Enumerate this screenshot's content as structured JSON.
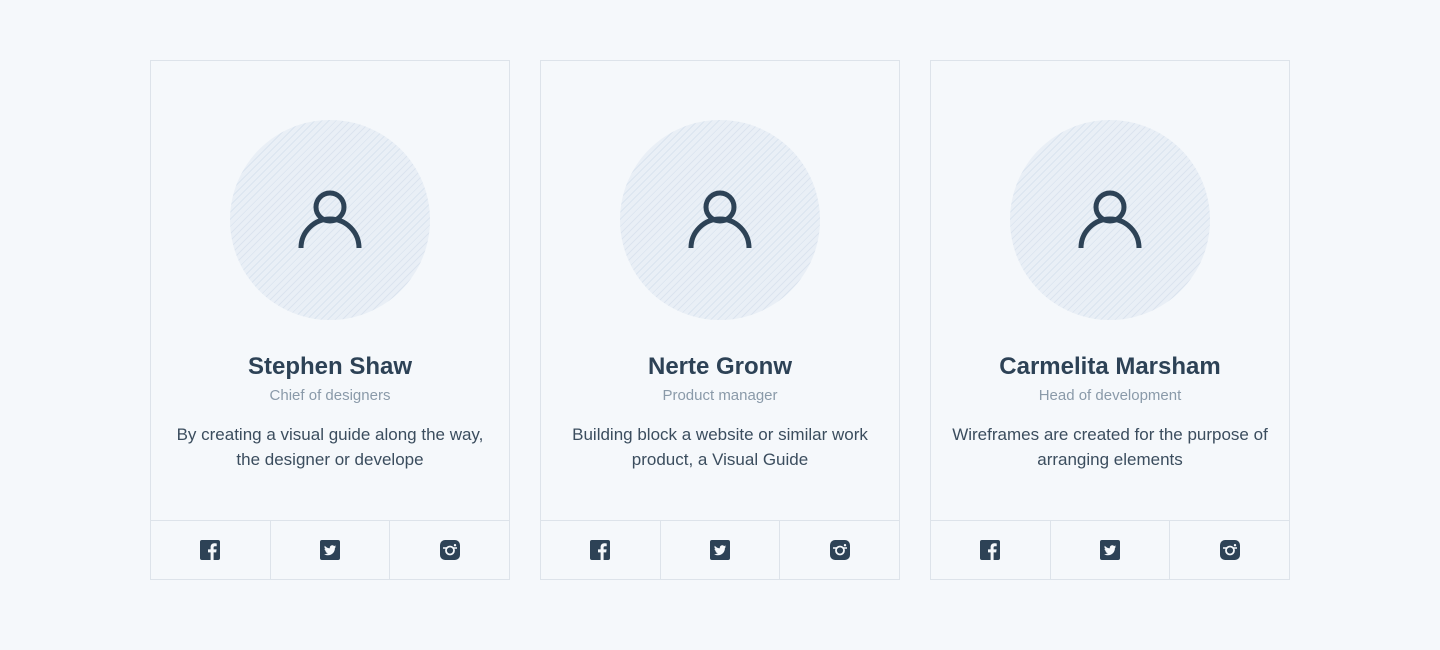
{
  "colors": {
    "background": "#f5f8fb",
    "card_border": "#dde3ea",
    "text_dark": "#2d4256",
    "text_muted": "#8a9aa9",
    "avatar_bg": "#e9eff6"
  },
  "team": [
    {
      "name": "Stephen Shaw",
      "role": "Chief of designers",
      "bio": "By creating a visual guide along the way, the designer or develope",
      "avatar_icon": "user-icon",
      "social": [
        "facebook-icon",
        "twitter-icon",
        "instagram-icon"
      ]
    },
    {
      "name": "Nerte Gronw",
      "role": "Product manager",
      "bio": "Building block a website or similar work product, a Visual Guide",
      "avatar_icon": "user-icon",
      "social": [
        "facebook-icon",
        "twitter-icon",
        "instagram-icon"
      ]
    },
    {
      "name": "Carmelita Marsham",
      "role": "Head of development",
      "bio": "Wireframes are created for the purpose of arranging elements",
      "avatar_icon": "user-icon",
      "social": [
        "facebook-icon",
        "twitter-icon",
        "instagram-icon"
      ]
    }
  ]
}
